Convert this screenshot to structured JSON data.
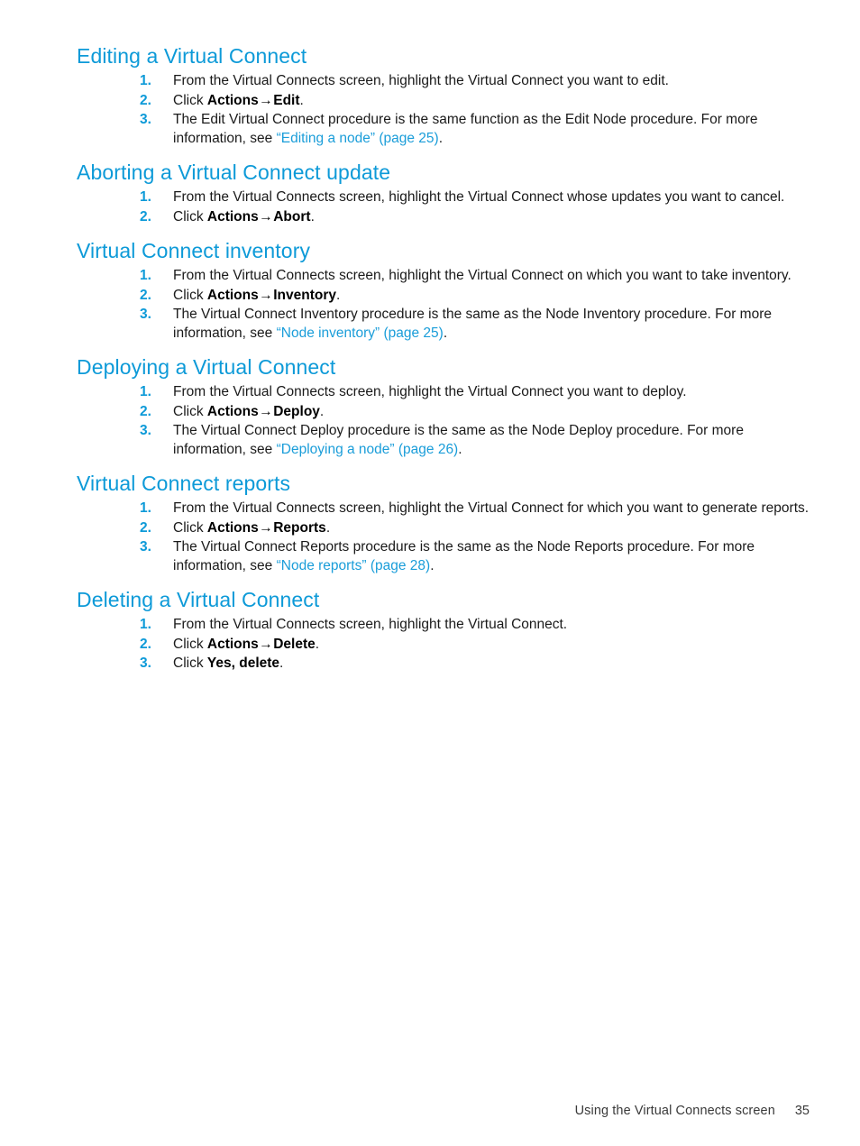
{
  "document": {
    "page_number": "35",
    "footer_title": "Using the Virtual Connects screen",
    "heading_color": "#0d9ad8",
    "link_color": "#1a9dd9",
    "body_color": "#1a1a1a"
  },
  "sections": [
    {
      "id": "editing",
      "heading": "Editing a Virtual Connect",
      "steps": [
        {
          "number": "1.",
          "parts": [
            {
              "type": "text",
              "text": "From the Virtual Connects screen, highlight the Virtual Connect you want to edit."
            }
          ]
        },
        {
          "number": "2.",
          "parts": [
            {
              "type": "text",
              "text": "Click "
            },
            {
              "type": "bold",
              "text": "Actions"
            },
            {
              "type": "arrow",
              "text": "→"
            },
            {
              "type": "bold",
              "text": "Edit"
            },
            {
              "type": "text",
              "text": "."
            }
          ]
        },
        {
          "number": "3.",
          "parts": [
            {
              "type": "text",
              "text": "The Edit Virtual Connect procedure is the same function as the Edit Node procedure. For more information, see "
            },
            {
              "type": "link",
              "text": "“Editing a node” (page 25)"
            },
            {
              "type": "text",
              "text": "."
            }
          ]
        }
      ]
    },
    {
      "id": "aborting",
      "heading": "Aborting a Virtual Connect update",
      "steps": [
        {
          "number": "1.",
          "parts": [
            {
              "type": "text",
              "text": "From the Virtual Connects screen, highlight the Virtual Connect whose updates you want to cancel."
            }
          ]
        },
        {
          "number": "2.",
          "parts": [
            {
              "type": "text",
              "text": "Click "
            },
            {
              "type": "bold",
              "text": "Actions"
            },
            {
              "type": "arrow",
              "text": "→"
            },
            {
              "type": "bold",
              "text": "Abort"
            },
            {
              "type": "text",
              "text": "."
            }
          ]
        }
      ]
    },
    {
      "id": "inventory",
      "heading": "Virtual Connect inventory",
      "steps": [
        {
          "number": "1.",
          "parts": [
            {
              "type": "text",
              "text": "From the Virtual Connects screen, highlight the Virtual Connect on which you want to take inventory."
            }
          ]
        },
        {
          "number": "2.",
          "parts": [
            {
              "type": "text",
              "text": "Click "
            },
            {
              "type": "bold",
              "text": "Actions"
            },
            {
              "type": "arrow",
              "text": "→"
            },
            {
              "type": "bold",
              "text": "Inventory"
            },
            {
              "type": "text",
              "text": "."
            }
          ]
        },
        {
          "number": "3.",
          "parts": [
            {
              "type": "text",
              "text": "The Virtual Connect Inventory procedure is the same as the Node Inventory procedure. For more information, see "
            },
            {
              "type": "link",
              "text": "“Node inventory” (page 25)"
            },
            {
              "type": "text",
              "text": "."
            }
          ]
        }
      ]
    },
    {
      "id": "deploying",
      "heading": "Deploying a Virtual Connect",
      "steps": [
        {
          "number": "1.",
          "parts": [
            {
              "type": "text",
              "text": "From the Virtual Connects screen, highlight the Virtual Connect you want to deploy."
            }
          ]
        },
        {
          "number": "2.",
          "parts": [
            {
              "type": "text",
              "text": "Click "
            },
            {
              "type": "bold",
              "text": "Actions"
            },
            {
              "type": "arrow",
              "text": "→"
            },
            {
              "type": "bold",
              "text": "Deploy"
            },
            {
              "type": "text",
              "text": "."
            }
          ]
        },
        {
          "number": "3.",
          "parts": [
            {
              "type": "text",
              "text": "The Virtual Connect Deploy procedure is the same as the Node Deploy procedure. For more information, see "
            },
            {
              "type": "link",
              "text": "“Deploying a node” (page 26)"
            },
            {
              "type": "text",
              "text": "."
            }
          ]
        }
      ]
    },
    {
      "id": "reports",
      "heading": "Virtual Connect reports",
      "steps": [
        {
          "number": "1.",
          "parts": [
            {
              "type": "text",
              "text": "From the Virtual Connects screen, highlight the Virtual Connect for which you want to generate reports."
            }
          ]
        },
        {
          "number": "2.",
          "parts": [
            {
              "type": "text",
              "text": "Click "
            },
            {
              "type": "bold",
              "text": "Actions"
            },
            {
              "type": "arrow",
              "text": "→"
            },
            {
              "type": "bold",
              "text": "Reports"
            },
            {
              "type": "text",
              "text": "."
            }
          ]
        },
        {
          "number": "3.",
          "parts": [
            {
              "type": "text",
              "text": "The Virtual Connect Reports procedure is the same as the Node Reports procedure. For more information, see "
            },
            {
              "type": "link",
              "text": "“Node reports” (page 28)"
            },
            {
              "type": "text",
              "text": "."
            }
          ]
        }
      ]
    },
    {
      "id": "deleting",
      "heading": "Deleting a Virtual Connect",
      "steps": [
        {
          "number": "1.",
          "parts": [
            {
              "type": "text",
              "text": "From the Virtual Connects screen, highlight the Virtual Connect."
            }
          ]
        },
        {
          "number": "2.",
          "parts": [
            {
              "type": "text",
              "text": "Click "
            },
            {
              "type": "bold",
              "text": "Actions"
            },
            {
              "type": "arrow",
              "text": "→"
            },
            {
              "type": "bold",
              "text": "Delete"
            },
            {
              "type": "text",
              "text": "."
            }
          ]
        },
        {
          "number": "3.",
          "parts": [
            {
              "type": "text",
              "text": "Click "
            },
            {
              "type": "bold",
              "text": "Yes, delete"
            },
            {
              "type": "text",
              "text": "."
            }
          ]
        }
      ]
    }
  ]
}
